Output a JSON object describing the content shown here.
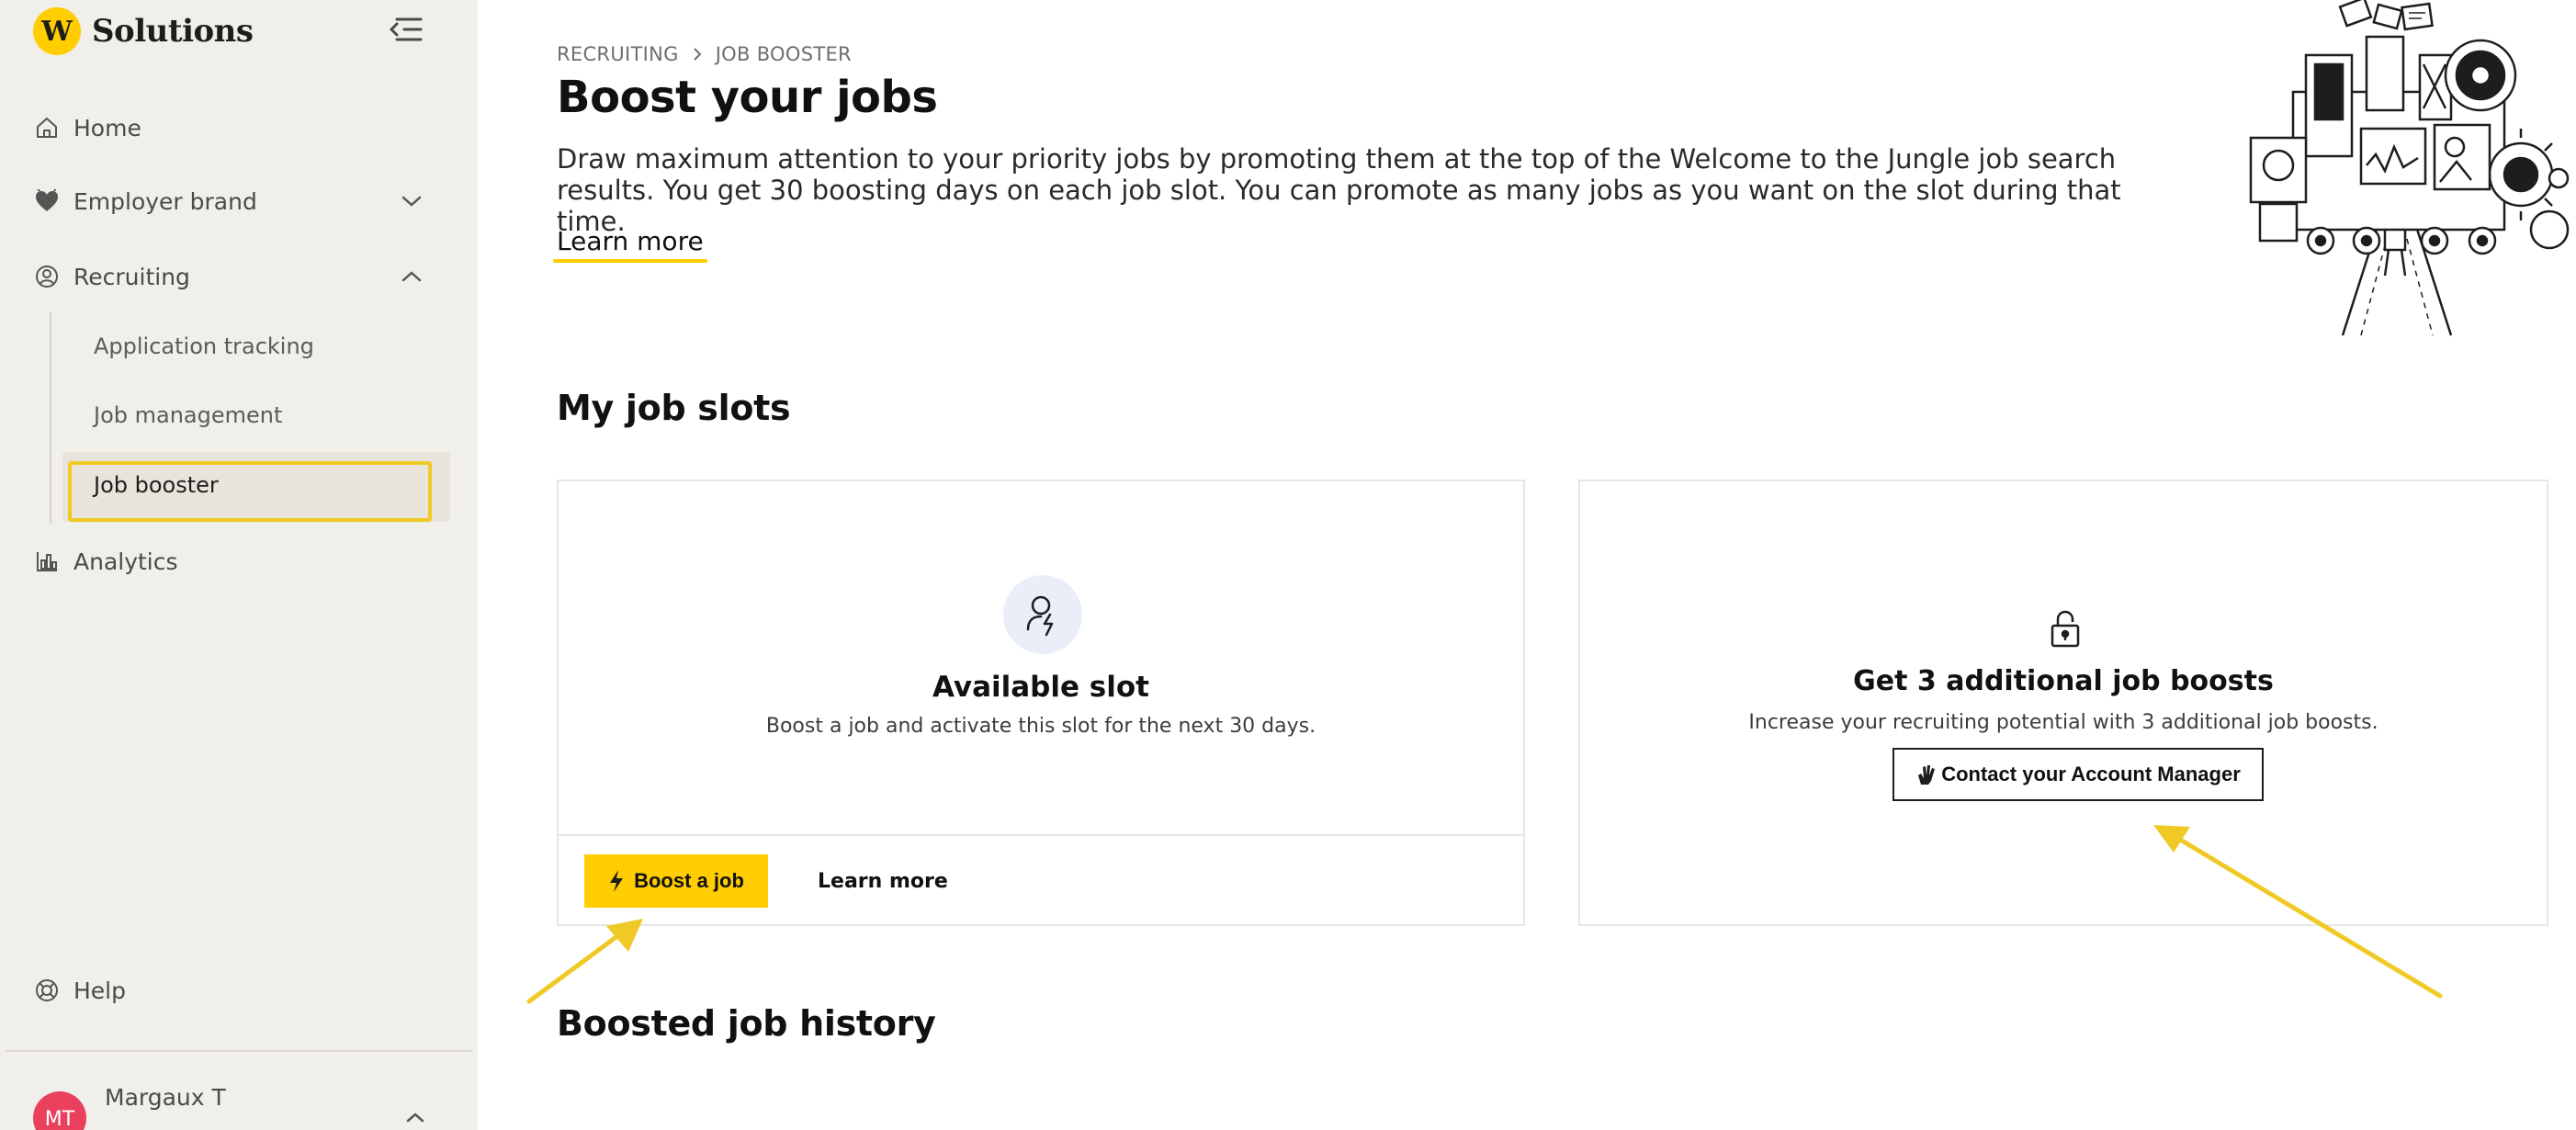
{
  "brand": {
    "logo_letter": "W",
    "name": "Solutions"
  },
  "sidebar": {
    "items": [
      {
        "label": "Home",
        "icon": "home-icon"
      },
      {
        "label": "Employer brand",
        "icon": "heart-icon"
      },
      {
        "label": "Recruiting",
        "icon": "recruiting-icon"
      },
      {
        "label": "Analytics",
        "icon": "analytics-icon"
      }
    ],
    "recruiting_sub": [
      {
        "label": "Application tracking"
      },
      {
        "label": "Job management"
      },
      {
        "label": "Job booster",
        "active": true
      }
    ],
    "help_label": "Help",
    "user": {
      "initials": "MT",
      "name": "Margaux T"
    }
  },
  "header": {
    "breadcrumb": [
      "RECRUITING",
      "JOB BOOSTER"
    ],
    "title": "Boost your jobs",
    "description": "Draw maximum attention to your priority jobs by promoting them at the top of the Welcome to the Jungle job search results. You get 30 boosting days on each job slot. You can promote as many jobs as you want on the slot during that time.",
    "learn_more": "Learn more"
  },
  "slots_section": {
    "title": "My job slots",
    "available": {
      "title": "Available slot",
      "description": "Boost a job and activate this slot for the next 30 days.",
      "boost_button": "Boost a job",
      "learn_more": "Learn more"
    },
    "additional": {
      "title": "Get 3 additional job boosts",
      "description": "Increase your recruiting potential with 3 additional job boosts.",
      "contact_button": "Contact your Account Manager"
    }
  },
  "history_section": {
    "title": "Boosted job history"
  },
  "colors": {
    "accent": "#ffcd00",
    "sidebar_bg": "#f1efea",
    "avatar": "#e9405d",
    "highlight_box": "#f0c927"
  }
}
